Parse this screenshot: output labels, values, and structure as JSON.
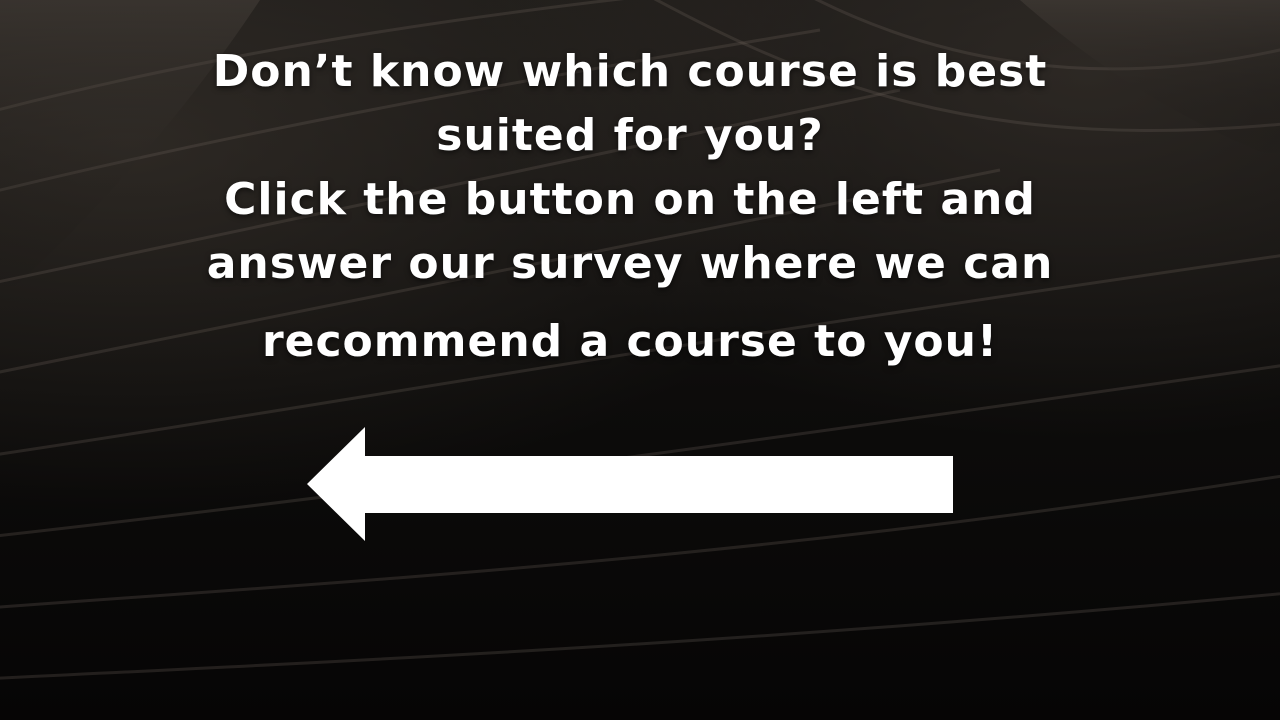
{
  "slide": {
    "lines": [
      "Don’t know which course is best",
      "suited for you?",
      "Click the button on the left and",
      "answer our survey where we can",
      "recommend a course to you!"
    ]
  },
  "arrow": {
    "icon": "arrow-left-icon",
    "color": "#ffffff"
  }
}
